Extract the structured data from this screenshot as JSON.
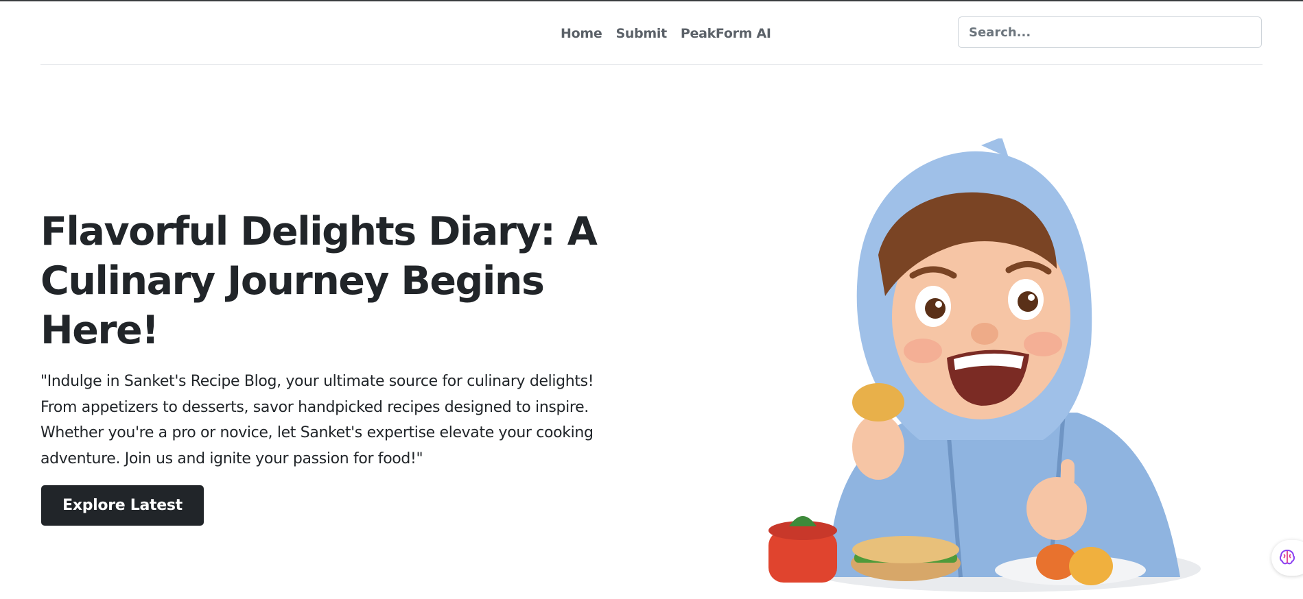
{
  "nav": {
    "links": [
      "Home",
      "Submit",
      "PeakForm AI"
    ],
    "search_placeholder": "Search..."
  },
  "hero": {
    "title": "Flavorful Delights Diary: A Culinary Journey Begins Here!",
    "description": "\"Indulge in Sanket's Recipe Blog, your ultimate source for culinary delights! From appetizers to desserts, savor handpicked recipes designed to inspire. Whether you're a pro or novice, let Sanket's expertise elevate your cooking adventure. Join us and ignite your passion for food!\"",
    "cta_label": "Explore Latest",
    "image": "cartoon-boy-eating-illustration"
  },
  "floating_widget": {
    "icon": "brain-icon"
  },
  "colors": {
    "text": "#212529",
    "nav_link": "#5b6168",
    "button_bg": "#212529",
    "hoodie": "#8fb4e0"
  }
}
